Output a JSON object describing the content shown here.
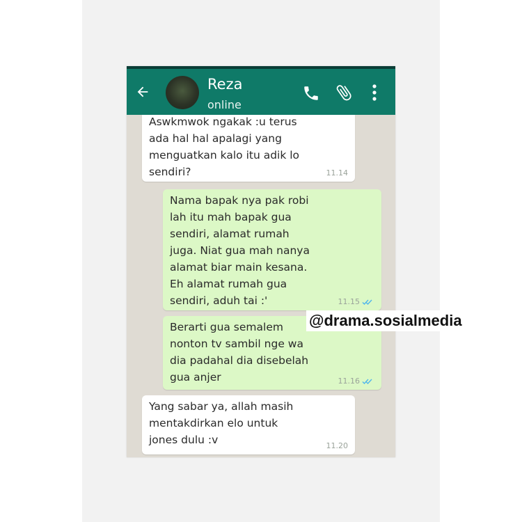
{
  "contact": {
    "name": "Reza",
    "status": "online"
  },
  "icons": {
    "back": "back-arrow-icon",
    "call": "phone-icon",
    "attach": "paperclip-icon",
    "menu": "more-vertical-icon"
  },
  "colors": {
    "header": "#0f7a68",
    "incoming_bubble": "#ffffff",
    "outgoing_bubble": "#dcf8c6",
    "read_ticks": "#4fb6ec"
  },
  "messages": [
    {
      "direction": "incoming",
      "text": "Aswkmwok ngakak :u terus\nada hal hal apalagi yang\nmenguatkan kalo itu adik lo\nsendiri?",
      "time": "11.14"
    },
    {
      "direction": "outgoing",
      "text": "Nama bapak nya pak robi\nlah itu mah bapak gua\nsendiri, alamat rumah\njuga. Niat gua mah nanya\nalamat biar main kesana.\nEh alamat rumah gua\nsendiri, aduh tai :'",
      "time": "11.15",
      "read": true
    },
    {
      "direction": "outgoing",
      "text": "Berarti gua semalem\nnonton tv sambil nge wa\ndia padahal dia disebelah\ngua anjer",
      "time": "11.16",
      "read": true
    },
    {
      "direction": "incoming",
      "text": "Yang sabar ya, allah masih\nmentakdirkan elo untuk\njones dulu :v",
      "time": "11.20"
    }
  ],
  "watermark": "@drama.sosialmedia"
}
